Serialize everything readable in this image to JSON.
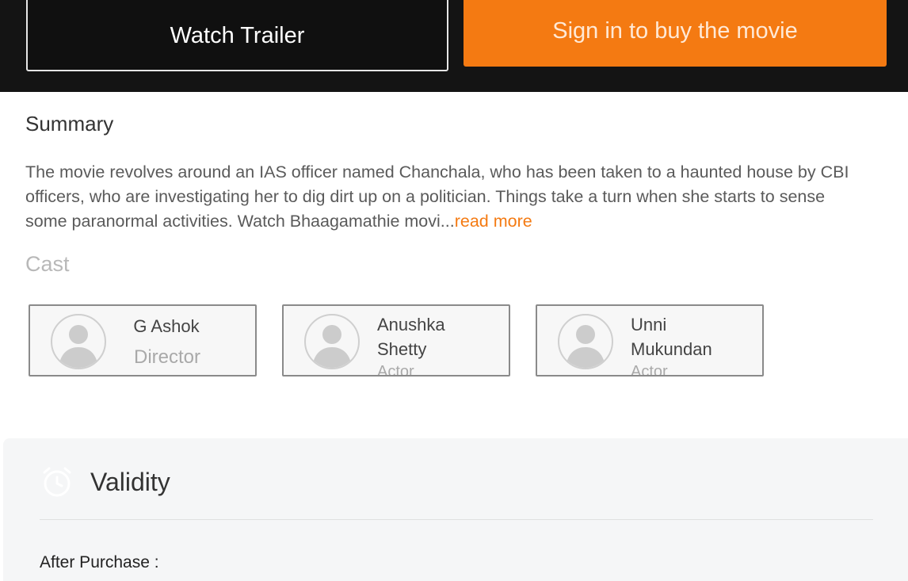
{
  "actions": {
    "watch_trailer": "Watch Trailer",
    "buy": "Sign in to buy the movie"
  },
  "summary": {
    "heading": "Summary",
    "text": "The movie revolves around an IAS officer named Chanchala, who has been taken to a haunted house by CBI officers, who are investigating her to dig dirt up on a politician. Things take a turn when she starts to sense some paranormal activities. Watch Bhaagamathie movi...",
    "read_more": "read more"
  },
  "cast": {
    "heading": "Cast",
    "members": [
      {
        "name": "G Ashok",
        "role": "Director"
      },
      {
        "name": "Anushka Shetty",
        "role": "Actor"
      },
      {
        "name": "Unni Mukundan",
        "role": "Actor"
      }
    ]
  },
  "validity": {
    "heading": "Validity",
    "icon": "alarm-clock-icon",
    "after_purchase_label": "After Purchase :"
  },
  "colors": {
    "accent": "#f47a12",
    "topbar": "#141414"
  }
}
